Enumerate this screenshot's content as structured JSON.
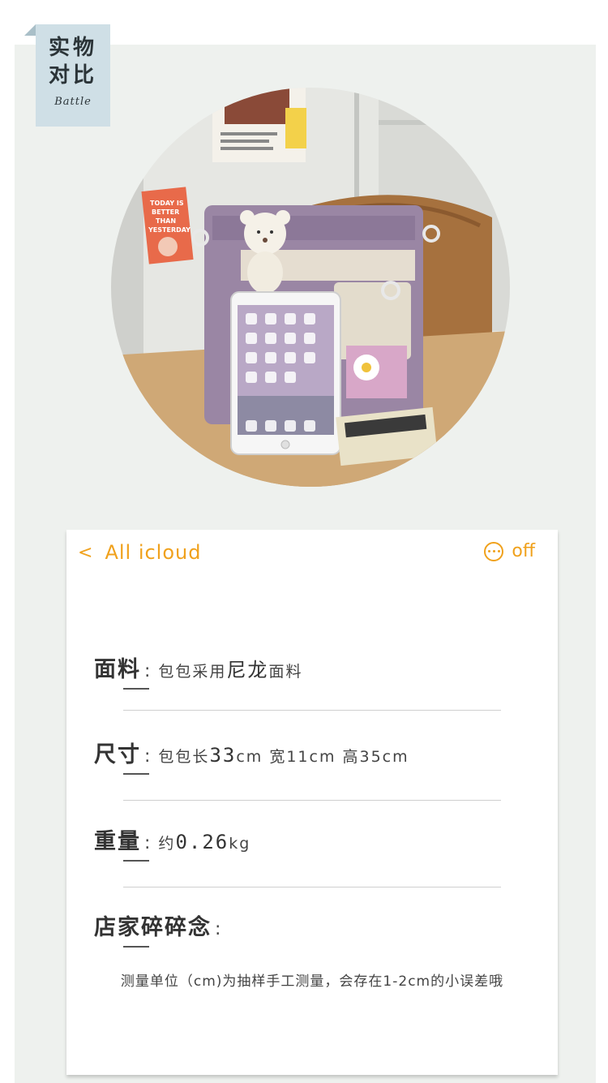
{
  "tag": {
    "line1": "实物",
    "line2": "对比",
    "subtitle": "Battle"
  },
  "photo": {
    "sign_text": [
      "TODAY IS",
      "BETTER",
      "THAN",
      "YESTERDAY"
    ]
  },
  "card": {
    "nav": {
      "back_icon": "chevron-left-icon",
      "back_label": "All icloud",
      "more_icon": "more-dots-icon",
      "more_label": "off"
    },
    "rows": [
      {
        "label": "面料",
        "value_prefix": "包包采用",
        "value_em": "尼龙",
        "value_suffix": "面料"
      },
      {
        "label": "尺寸",
        "value_prefix": "包包长",
        "value_em": "33",
        "value_suffix": "cm  宽11cm  高35cm"
      },
      {
        "label": "重量",
        "value_prefix": "约",
        "value_em": "0.26",
        "value_suffix": "kg"
      },
      {
        "label": "店家碎碎念",
        "value_prefix": "",
        "value_em": "",
        "value_suffix": ""
      }
    ],
    "note": "测量单位（cm)为抽样手工测量，会存在1-2cm的小误差哦"
  },
  "colors": {
    "accent": "#f0a11c",
    "panel_bg": "#eef1ee",
    "tag_bg": "#cfdfe6"
  }
}
